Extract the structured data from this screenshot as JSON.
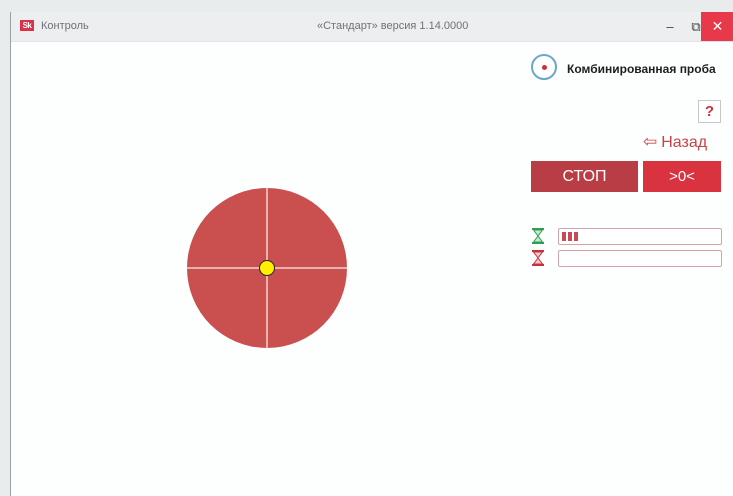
{
  "window": {
    "title": "Контроль",
    "version_title": "«Стандарт» версия 1.14.0000",
    "controls": {
      "minimize": "–",
      "maximize": "⧉",
      "close": "✕"
    }
  },
  "mode": {
    "label": "Комбинированная проба",
    "selected": true
  },
  "help": {
    "label": "?"
  },
  "back": {
    "label": "Назад",
    "icon": "left-arrow-icon"
  },
  "buttons": {
    "stop": "СТОП",
    "zero": ">0<"
  },
  "progress": [
    {
      "icon": "hourglass-green-icon",
      "value": 0.12
    },
    {
      "icon": "hourglass-red-icon",
      "value": 0.0
    }
  ],
  "colors": {
    "target": "#c9504f",
    "crosshair": "#f2d2d0",
    "marker": "#ffee00",
    "accent": "#d8333f",
    "stop": "#b93d45"
  }
}
